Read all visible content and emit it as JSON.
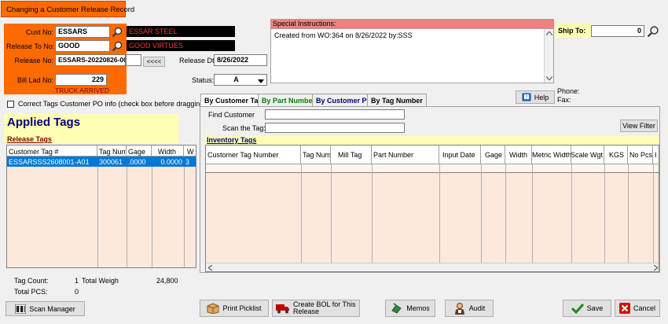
{
  "window_title": "Changing a Customer Release Record",
  "header": {
    "cust_no_label": "Cust No:",
    "cust_no_value": "ESSARS",
    "cust_name": "ESSAR STEEL",
    "release_to_label": "Release To No:",
    "release_to_value": "GOOD",
    "release_to_name": "GOOD VIRTUES",
    "release_no_label": "Release No:",
    "release_no_value": "ESSARS-20220826-001",
    "bill_lad_label": "Bill Lad No:",
    "bill_lad_value": "229",
    "truck_status": "TRUCK ARRIVED",
    "arrows_label": "<<<<",
    "release_dt_label": "Release Dt:",
    "release_dt_value": "8/26/2022",
    "status_label": "Status:",
    "status_value": "A"
  },
  "special_instructions": {
    "label": "Special Instructions:",
    "text": "Created from WO:364 on  8/26/2022 by:SSS"
  },
  "ship_to": {
    "label": "Ship To:",
    "value": "0",
    "phone_label": "Phone:",
    "fax_label": "Fax:"
  },
  "correct_tags_label": "Correct Tags Customer PO info (check box before dragging)",
  "applied": {
    "title": "Applied Tags",
    "release_tags_label": "Release Tags",
    "columns": [
      "Customer Tag #",
      "Tag Num",
      "Gage",
      "Width",
      "W"
    ],
    "rows": [
      {
        "tag": "ESSARSSS2608001-A01",
        "tag_num": "300061",
        "gage": ".0000",
        "width": "0.0000",
        "w": "3"
      }
    ],
    "tag_count_label": "Tag Count:",
    "tag_count_value": "1",
    "total_weight_label": "Total Weigh",
    "total_weight_value": "24,800",
    "total_pcs_label": "Total PCS:",
    "total_pcs_value": "0"
  },
  "tabs": [
    {
      "label": "By Customer Tag",
      "color": "#000000"
    },
    {
      "label": "By Part Number",
      "color": "#008000"
    },
    {
      "label": "By Customer PO",
      "color": "#000080"
    },
    {
      "label": "By Tag Number",
      "color": "#000000"
    }
  ],
  "help_label": "Help",
  "search": {
    "find_customer_label": "Find Customer",
    "find_customer_value": "",
    "scan_tag_label": "Scan the Tag:",
    "scan_tag_value": "",
    "view_filter_label": "View Filter"
  },
  "inventory": {
    "label": "Inventory Tags",
    "columns": [
      "Customer Tag Number",
      "Tag Num",
      "Mill Tag",
      "Part Number",
      "Input Date",
      "Gage",
      "Width",
      "Metric Width",
      "Scale Wgt",
      "KGS",
      "No Pcs",
      "I"
    ]
  },
  "buttons": {
    "scan_manager": "Scan Manager",
    "print_picklist": "Print Picklist",
    "create_bol": "Create BOL for This Release",
    "memos": "Memos",
    "audit": "Audit",
    "save": "Save",
    "cancel": "Cancel"
  },
  "colors": {
    "orange": "#ff6a00",
    "special_header": "#f08080",
    "ship_to_bg": "#ffffb3",
    "applied_bg": "#ffffb3",
    "grid_body": "#fde9dc",
    "selection": "#0078d7"
  }
}
